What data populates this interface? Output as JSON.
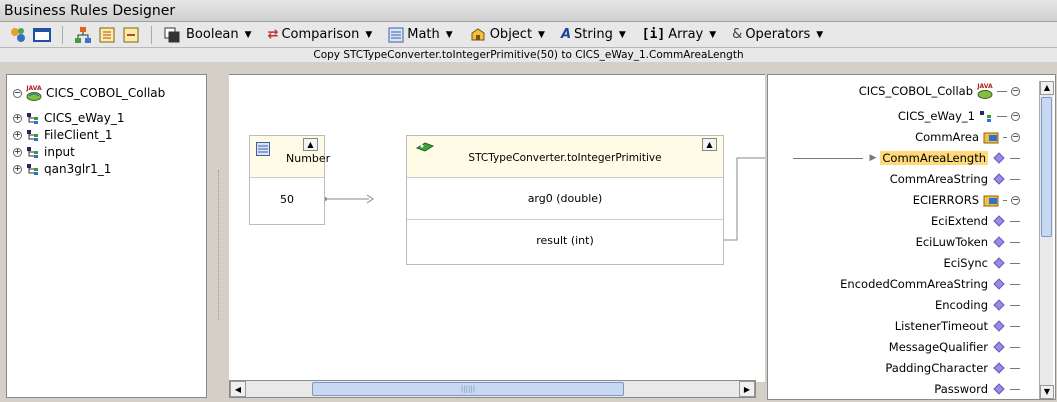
{
  "window": {
    "title": "Business Rules Designer"
  },
  "toolbar": {
    "menus": [
      {
        "label": "Boolean"
      },
      {
        "label": "Comparison"
      },
      {
        "label": "Math"
      },
      {
        "label": "Object"
      },
      {
        "label": "String"
      },
      {
        "label": "Array"
      },
      {
        "label": "Operators"
      }
    ],
    "array_icon_text": "[i]"
  },
  "status": {
    "text": "Copy STCTypeConverter.toIntegerPrimitive(50) to CICS_eWay_1.CommAreaLength"
  },
  "left_tree": {
    "items": [
      {
        "label": "CICS_COBOL_Collab",
        "icon": "java-collab-icon"
      },
      {
        "label": "CICS_eWay_1",
        "icon": "otd-icon"
      },
      {
        "label": "FileClient_1",
        "icon": "otd-icon"
      },
      {
        "label": "input",
        "icon": "otd-icon"
      },
      {
        "label": "qan3glr1_1",
        "icon": "otd-icon"
      }
    ],
    "java_badge": "JAVA"
  },
  "canvas": {
    "number_node": {
      "title": "Number",
      "value": "50"
    },
    "method_node": {
      "title": "STCTypeConverter.toIntegerPrimitive",
      "arg": "arg0 (double)",
      "result": "result (int)"
    }
  },
  "right_tree": {
    "items": [
      {
        "label": "CICS_COBOL_Collab",
        "icon": "java-collab-icon"
      },
      {
        "label": "CICS_eWay_1",
        "icon": "otd-icon"
      },
      {
        "label": "CommArea",
        "icon": "folder-icon"
      },
      {
        "label": "CommAreaLength",
        "icon": "field-icon",
        "selected": true
      },
      {
        "label": "CommAreaString",
        "icon": "field-icon"
      },
      {
        "label": "ECIERRORS",
        "icon": "folder-icon"
      },
      {
        "label": "EciExtend",
        "icon": "field-icon"
      },
      {
        "label": "EciLuwToken",
        "icon": "field-icon"
      },
      {
        "label": "EciSync",
        "icon": "field-icon"
      },
      {
        "label": "EncodedCommAreaString",
        "icon": "field-icon"
      },
      {
        "label": "Encoding",
        "icon": "field-icon"
      },
      {
        "label": "ListenerTimeout",
        "icon": "field-icon"
      },
      {
        "label": "MessageQualifier",
        "icon": "field-icon"
      },
      {
        "label": "PaddingCharacter",
        "icon": "field-icon"
      },
      {
        "label": "Password",
        "icon": "field-icon"
      }
    ]
  },
  "colors": {
    "selection": "#ffd97a",
    "node_header": "#fffbe6",
    "field_diamond": "#9a8ae0"
  }
}
